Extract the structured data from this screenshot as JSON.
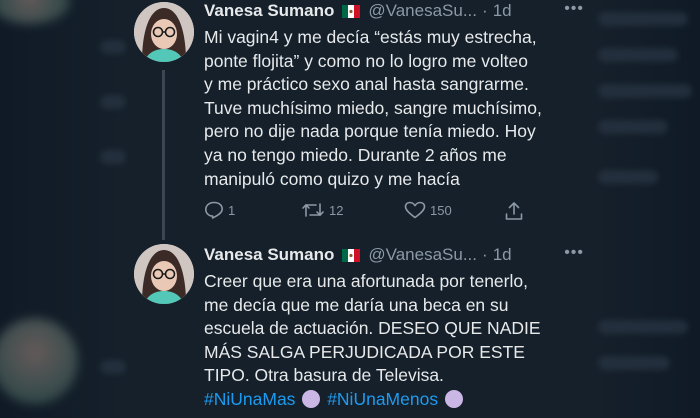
{
  "tweets": [
    {
      "author": {
        "name": "Vanesa Sumano",
        "handle": "@VanesaSu...",
        "time": "1d"
      },
      "text_lines": [
        "Mi vagin4 y me decía “estás muy estrecha,",
        "ponte flojita” y como no lo logro me volteo",
        "y me práctico sexo anal hasta sangrarme.",
        "Tuve muchísimo miedo, sangre muchísimo,",
        "pero no dije nada porque tenía miedo. Hoy",
        "ya no tengo miedo. Durante 2 años me",
        "manipuló como quizo y me hacía"
      ],
      "actions": {
        "replies": "1",
        "retweets": "12",
        "likes": "150"
      }
    },
    {
      "author": {
        "name": "Vanesa Sumano",
        "handle": "@VanesaSu...",
        "time": "1d"
      },
      "text_lines": [
        "Creer que era una afortunada por tenerlo,",
        "me decía que me daría una beca en su",
        "escuela de actuación. DESEO QUE NADIE",
        "MÁS SALGA PERJUDICADA POR ESTE",
        "TIPO. Otra basura de Televisa."
      ],
      "hashtags": [
        "#NiUnaMas",
        "#NiUnaMenos"
      ]
    }
  ],
  "icons": [
    "mexico-flag-icon",
    "more-icon",
    "reply-icon",
    "retweet-icon",
    "like-icon",
    "share-icon",
    "purple-heart-emoji"
  ],
  "colors": {
    "background": "#15202b",
    "text": "#e7e9ea",
    "secondary": "#8b98a5",
    "link": "#1d9bf0"
  }
}
